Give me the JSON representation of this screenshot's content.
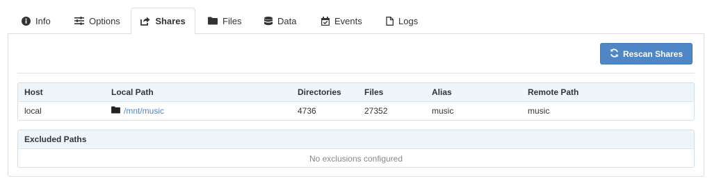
{
  "colors": {
    "accent": "#4f86c6",
    "header_bg": "#eef6fb",
    "border": "#dddddd"
  },
  "tabs": [
    {
      "label": "Info",
      "icon": "info-circle-icon",
      "active": false
    },
    {
      "label": "Options",
      "icon": "sliders-icon",
      "active": false
    },
    {
      "label": "Shares",
      "icon": "share-square-icon",
      "active": true
    },
    {
      "label": "Files",
      "icon": "folder-icon",
      "active": false
    },
    {
      "label": "Data",
      "icon": "database-icon",
      "active": false
    },
    {
      "label": "Events",
      "icon": "calendar-check-icon",
      "active": false
    },
    {
      "label": "Logs",
      "icon": "file-icon",
      "active": false
    }
  ],
  "toolbar": {
    "rescan_label": "Rescan Shares",
    "rescan_icon": "refresh-icon"
  },
  "shares": {
    "columns": [
      "Host",
      "Local Path",
      "Directories",
      "Files",
      "Alias",
      "Remote Path"
    ],
    "rows": [
      {
        "host": "local",
        "local_path": "/mnt/music",
        "local_path_icon": "folder-icon",
        "directories": "4736",
        "files": "27352",
        "alias": "music",
        "remote_path": "music"
      }
    ]
  },
  "excluded": {
    "title": "Excluded Paths",
    "empty_text": "No exclusions configured"
  }
}
